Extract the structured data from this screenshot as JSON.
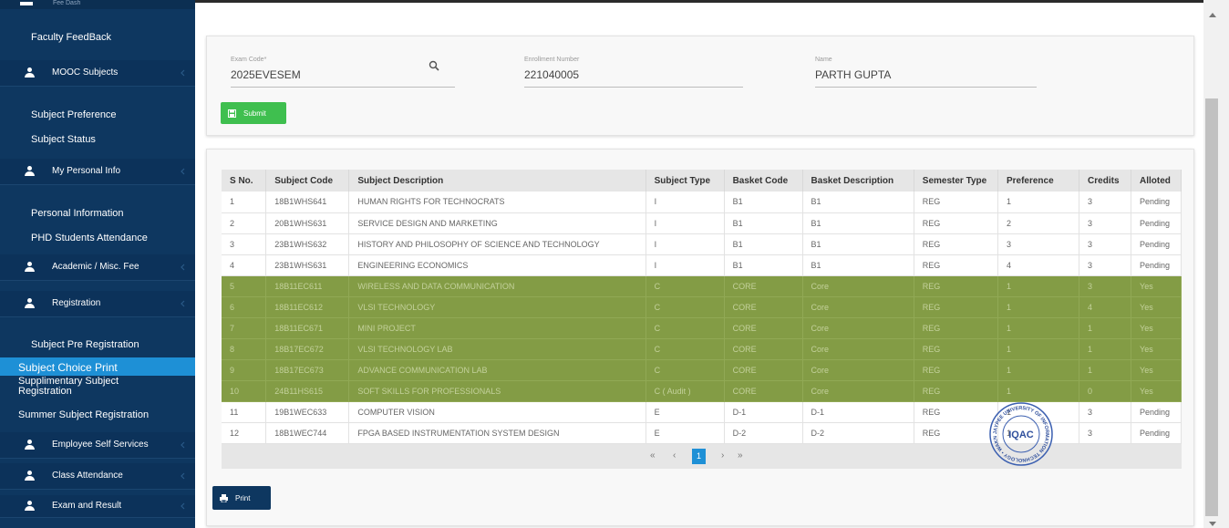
{
  "sidebar": {
    "top_partial": "Fee Dash",
    "items": [
      {
        "type": "link",
        "label": "Faculty FeedBack"
      },
      {
        "type": "section",
        "label": "MOOC Subjects"
      },
      {
        "type": "link",
        "label": "Subject Preference"
      },
      {
        "type": "link",
        "label": "Subject Status"
      },
      {
        "type": "section",
        "label": "My Personal Info"
      },
      {
        "type": "link",
        "label": "Personal Information"
      },
      {
        "type": "link",
        "label": "PHD Students Attendance"
      },
      {
        "type": "section",
        "label": "Academic / Misc. Fee"
      },
      {
        "type": "section",
        "label": "Registration"
      },
      {
        "type": "link",
        "label": "Subject Pre Registration"
      },
      {
        "type": "link",
        "label": "Subject Choice Print",
        "active": true
      },
      {
        "type": "link",
        "label": "Supplimentary Subject Registration"
      },
      {
        "type": "link",
        "label": "Summer Subject Registration"
      },
      {
        "type": "section",
        "label": "Employee Self Services"
      },
      {
        "type": "section",
        "label": "Class Attendance"
      },
      {
        "type": "section",
        "label": "Exam and Result"
      }
    ]
  },
  "form": {
    "exam_code": {
      "label": "Exam Code*",
      "value": "2025EVESEM"
    },
    "enrollment": {
      "label": "Enrollment Number",
      "value": "221040005"
    },
    "name": {
      "label": "Name",
      "value": "PARTH GUPTA"
    },
    "submit_label": "Submit"
  },
  "table": {
    "columns": [
      "S No.",
      "Subject Code",
      "Subject Description",
      "Subject Type",
      "Basket Code",
      "Basket Description",
      "Semester Type",
      "Preference",
      "Credits",
      "Alloted"
    ],
    "rows": [
      {
        "s_no": "1",
        "code": "18B1WHS641",
        "desc": "HUMAN RIGHTS FOR TECHNOCRATS",
        "type": "I",
        "basket_code": "B1",
        "basket_desc": "B1",
        "sem": "REG",
        "pref": "1",
        "credits": "3",
        "alloted": "Pending",
        "highlight": false
      },
      {
        "s_no": "2",
        "code": "20B1WHS631",
        "desc": "SERVICE DESIGN AND MARKETING",
        "type": "I",
        "basket_code": "B1",
        "basket_desc": "B1",
        "sem": "REG",
        "pref": "2",
        "credits": "3",
        "alloted": "Pending",
        "highlight": false
      },
      {
        "s_no": "3",
        "code": "23B1WHS632",
        "desc": "HISTORY AND PHILOSOPHY OF SCIENCE AND TECHNOLOGY",
        "type": "I",
        "basket_code": "B1",
        "basket_desc": "B1",
        "sem": "REG",
        "pref": "3",
        "credits": "3",
        "alloted": "Pending",
        "highlight": false
      },
      {
        "s_no": "4",
        "code": "23B1WHS631",
        "desc": "ENGINEERING ECONOMICS",
        "type": "I",
        "basket_code": "B1",
        "basket_desc": "B1",
        "sem": "REG",
        "pref": "4",
        "credits": "3",
        "alloted": "Pending",
        "highlight": false
      },
      {
        "s_no": "5",
        "code": "18B11EC611",
        "desc": "WIRELESS AND DATA COMMUNICATION",
        "type": "C",
        "basket_code": "CORE",
        "basket_desc": "Core",
        "sem": "REG",
        "pref": "1",
        "credits": "3",
        "alloted": "Yes",
        "highlight": true
      },
      {
        "s_no": "6",
        "code": "18B11EC612",
        "desc": "VLSI TECHNOLOGY",
        "type": "C",
        "basket_code": "CORE",
        "basket_desc": "Core",
        "sem": "REG",
        "pref": "1",
        "credits": "4",
        "alloted": "Yes",
        "highlight": true
      },
      {
        "s_no": "7",
        "code": "18B11EC671",
        "desc": "MINI PROJECT",
        "type": "C",
        "basket_code": "CORE",
        "basket_desc": "Core",
        "sem": "REG",
        "pref": "1",
        "credits": "1",
        "alloted": "Yes",
        "highlight": true
      },
      {
        "s_no": "8",
        "code": "18B17EC672",
        "desc": "VLSI TECHNOLOGY LAB",
        "type": "C",
        "basket_code": "CORE",
        "basket_desc": "Core",
        "sem": "REG",
        "pref": "1",
        "credits": "1",
        "alloted": "Yes",
        "highlight": true
      },
      {
        "s_no": "9",
        "code": "18B17EC673",
        "desc": "ADVANCE COMMUNICATION LAB",
        "type": "C",
        "basket_code": "CORE",
        "basket_desc": "Core",
        "sem": "REG",
        "pref": "1",
        "credits": "1",
        "alloted": "Yes",
        "highlight": true
      },
      {
        "s_no": "10",
        "code": "24B11HS615",
        "desc": "SOFT SKILLS FOR PROFESSIONALS",
        "type": "C ( Audit )",
        "basket_code": "CORE",
        "basket_desc": "Core",
        "sem": "REG",
        "pref": "1",
        "credits": "0",
        "alloted": "Yes",
        "highlight": true
      },
      {
        "s_no": "11",
        "code": "19B1WEC633",
        "desc": "COMPUTER VISION",
        "type": "E",
        "basket_code": "D-1",
        "basket_desc": "D-1",
        "sem": "REG",
        "pref": "1",
        "credits": "3",
        "alloted": "Pending",
        "highlight": false
      },
      {
        "s_no": "12",
        "code": "18B1WEC744",
        "desc": "FPGA BASED INSTRUMENTATION SYSTEM DESIGN",
        "type": "E",
        "basket_code": "D-2",
        "basket_desc": "D-2",
        "sem": "REG",
        "pref": "1",
        "credits": "3",
        "alloted": "Pending",
        "highlight": false
      }
    ]
  },
  "pager": {
    "first": "«",
    "prev": "‹",
    "current": "1",
    "next": "›",
    "last": "»"
  },
  "print_label": "Print",
  "stamp": {
    "center_text": "IQAC",
    "ring_text": "JAYPEE UNIVERSITY OF INFORMATION TECHNOLOGY • WAKNAGHAT •"
  },
  "colors": {
    "sidebar_bg": "#0e3760",
    "active_item": "#1e90d6",
    "submit_green": "#3fbf4f",
    "alloted_row": "#839c45"
  }
}
